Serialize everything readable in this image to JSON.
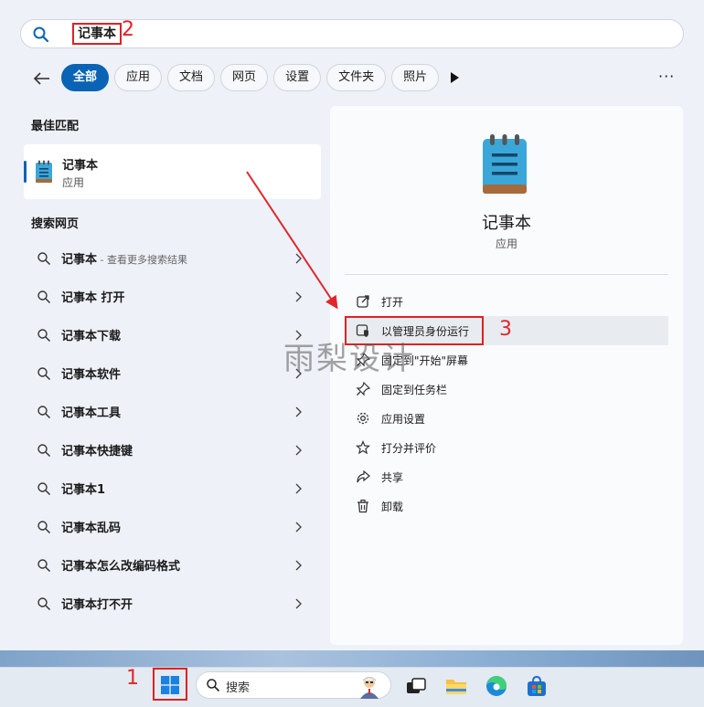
{
  "search": {
    "query": "记事本"
  },
  "annotations": {
    "n1": "1",
    "n2": "2",
    "n3": "3"
  },
  "tabs": [
    {
      "label": "全部",
      "active": true
    },
    {
      "label": "应用"
    },
    {
      "label": "文档"
    },
    {
      "label": "网页"
    },
    {
      "label": "设置"
    },
    {
      "label": "文件夹"
    },
    {
      "label": "照片"
    }
  ],
  "left": {
    "best_match_title": "最佳匹配",
    "best_match": {
      "name": "记事本",
      "type": "应用"
    },
    "web_title": "搜索网页",
    "web_items": [
      {
        "label": "记事本",
        "hint": " - 查看更多搜索结果"
      },
      {
        "label": "记事本 打开",
        "hint": ""
      },
      {
        "label": "记事本下载",
        "hint": ""
      },
      {
        "label": "记事本软件",
        "hint": ""
      },
      {
        "label": "记事本工具",
        "hint": ""
      },
      {
        "label": "记事本快捷键",
        "hint": ""
      },
      {
        "label": "记事本1",
        "hint": ""
      },
      {
        "label": "记事本乱码",
        "hint": ""
      },
      {
        "label": "记事本怎么改编码格式",
        "hint": ""
      },
      {
        "label": "记事本打不开",
        "hint": ""
      }
    ]
  },
  "detail": {
    "title": "记事本",
    "subtitle": "应用",
    "actions": [
      {
        "label": "打开",
        "icon": "open-external-icon"
      },
      {
        "label": "以管理员身份运行",
        "icon": "shield-icon"
      },
      {
        "label": "固定到\"开始\"屏幕",
        "icon": "pin-icon"
      },
      {
        "label": "固定到任务栏",
        "icon": "pin-icon"
      },
      {
        "label": "应用设置",
        "icon": "gear-icon"
      },
      {
        "label": "打分并评价",
        "icon": "star-icon"
      },
      {
        "label": "共享",
        "icon": "share-icon"
      },
      {
        "label": "卸载",
        "icon": "trash-icon"
      }
    ]
  },
  "watermark": "雨梨设计",
  "taskbar": {
    "search_placeholder": "搜索"
  },
  "colors": {
    "accent": "#0b63b5",
    "annotation_red": "#e0262c"
  }
}
